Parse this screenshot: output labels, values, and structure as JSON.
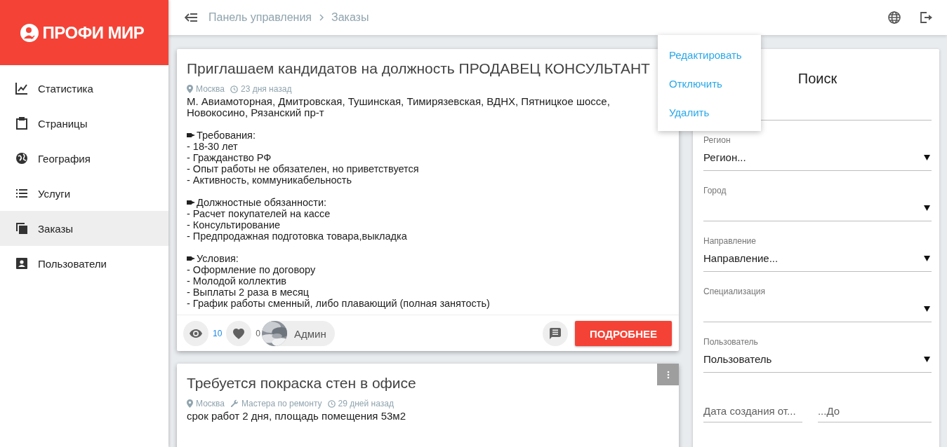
{
  "brand": {
    "name": "ПРОФИ МИР"
  },
  "sidebar": {
    "items": [
      {
        "label": "Статистика",
        "kind": "chart",
        "selected": false
      },
      {
        "label": "Страницы",
        "kind": "clipboard",
        "selected": false
      },
      {
        "label": "География",
        "kind": "globe",
        "selected": false
      },
      {
        "label": "Услуги",
        "kind": "list",
        "selected": false
      },
      {
        "label": "Заказы",
        "kind": "copies",
        "selected": true
      },
      {
        "label": "Пользователи",
        "kind": "account",
        "selected": false
      }
    ]
  },
  "breadcrumb": [
    "Панель управления",
    "Заказы"
  ],
  "orders": [
    {
      "title": "Приглашаем кандидатов на должность ПРОДАВЕЦ КОНСУЛЬТАНТ",
      "meta": [
        {
          "kind": "location",
          "text": "Москва"
        },
        {
          "kind": "time",
          "text": "23 дня назад"
        }
      ],
      "intro": "М. Авиамоторная, Дмитровская, Тушинская, Тимирязевская, ВДНХ, Пятницкое шоссе, Новокосино, Рязанский пр-т",
      "sections": [
        {
          "heading": "Требования:",
          "items": [
            "- 18-30 лет",
            "- Гражданство РФ",
            "- Опыт работы не обязателен, но приветствуется",
            "- Активность, коммуникабельность"
          ]
        },
        {
          "heading": "Должностные обязанности:",
          "items": [
            "- Расчет покупателей на кассе",
            "- Консультирование",
            "- Предпродажная подготовка товара,выкладка"
          ]
        },
        {
          "heading": "Условия:",
          "items": [
            "- Оформление по договору",
            "- Молодой коллектив",
            "- Выплаты 2 раза в месяц",
            "- График работы сменный, либо плавающий (полная занятость)"
          ]
        }
      ],
      "footer": {
        "views": "10",
        "likes": "0",
        "author": "Админ",
        "action": "ПОДРОБНЕЕ"
      }
    },
    {
      "title": "Требуется покраска стен в офисе",
      "meta": [
        {
          "kind": "location",
          "text": "Москва"
        },
        {
          "kind": "category",
          "text": "Мастера по ремонту"
        },
        {
          "kind": "time",
          "text": "29 дней назад"
        }
      ],
      "intro": "срок работ 2 дня, площадь помещения 53м2"
    }
  ],
  "context_menu": {
    "items": [
      "Редактировать",
      "Отключить",
      "Удалить"
    ]
  },
  "search": {
    "title": "Поиск",
    "filters": [
      {
        "label": "Регион",
        "value": "Регион..."
      },
      {
        "label": "Город"
      },
      {
        "label": "Направление",
        "value": "Направление..."
      },
      {
        "label": "Специализация"
      },
      {
        "label": "Пользователь",
        "value": "Пользователь"
      }
    ],
    "dates": [
      {
        "placeholder": "Дата создания от..."
      },
      {
        "placeholder": "...До"
      }
    ]
  }
}
